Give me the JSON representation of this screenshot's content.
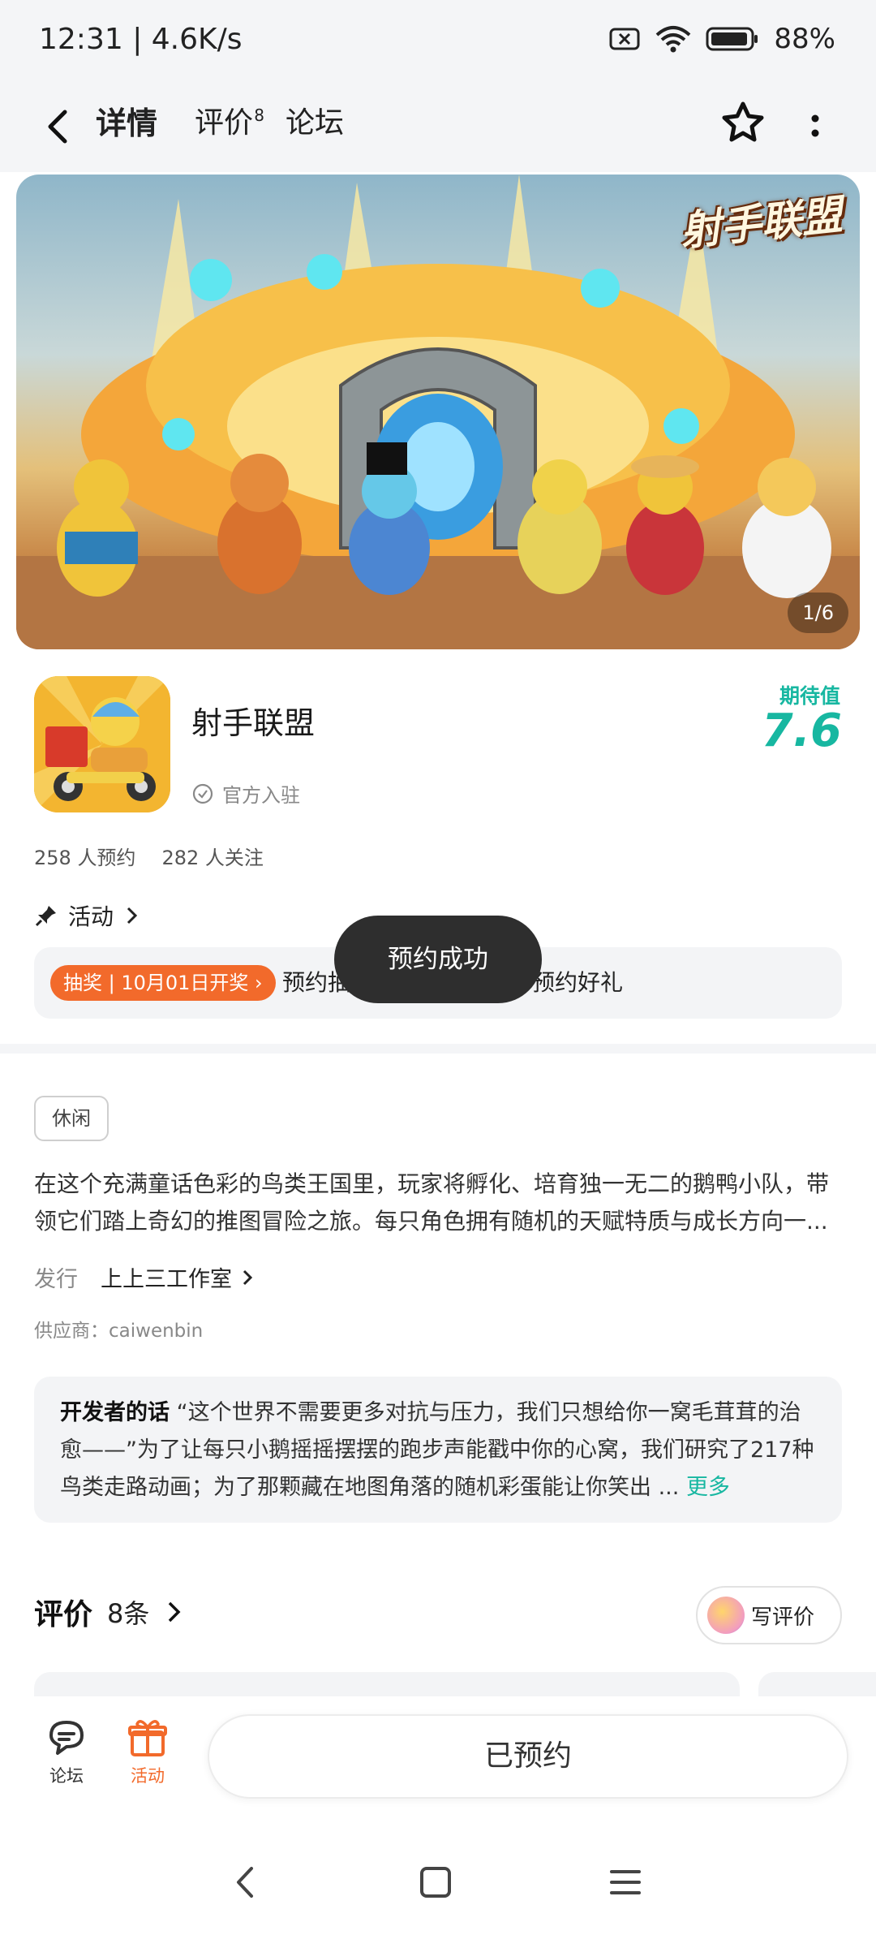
{
  "status_bar": {
    "time_speed": "12:31 | 4.6K/s",
    "battery": "88%"
  },
  "nav": {
    "tab_detail": "详情",
    "tab_review": "评价",
    "tab_review_badge": "8",
    "tab_forum": "论坛"
  },
  "banner": {
    "logo_text": "射手联盟",
    "counter": "1/6"
  },
  "app": {
    "name": "射手联盟",
    "official": "官方入驻",
    "score_label": "期待值",
    "score_value": "7.6",
    "reservations": "258 人预约",
    "followers": "282 人关注"
  },
  "activity": {
    "title": "活动",
    "badge": "抽奖 | 10月01日开奖",
    "text": "预约抽奖送【射手联盟】预约好礼"
  },
  "toast": "预约成功",
  "details": {
    "tag": "休闲",
    "description": "在这个充满童话色彩的鸟类王国里，玩家将孵化、培育独一无二的鹅鸭小队，带领它们踏上奇幻的推图冒险之旅。每只角色拥有随机的天赋特质与成长方向一...",
    "publisher_label": "发行",
    "publisher_value": "上上三工作室",
    "supplier": "供应商：caiwenbin"
  },
  "developer_note": {
    "title": "开发者的话",
    "text": "“这个世界不需要更多对抗与压力，我们只想给你一窝毛茸茸的治愈——”为了让每只小鹅摇摇摆摆的跑步声能戳中你的心窝，我们研究了217种鸟类走路动画；为了那颗藏在地图角落的随机彩蛋能让你笑出 ...",
    "more": "更多"
  },
  "reviews": {
    "title": "评价",
    "count": "8条",
    "write_button": "写评价"
  },
  "bottom_bar": {
    "forum": "论坛",
    "activity": "活动",
    "reserved_button": "已预约"
  },
  "colors": {
    "accent_teal": "#17b7a1",
    "accent_orange": "#f26a2b",
    "tab_underline": "#16d0b5"
  }
}
